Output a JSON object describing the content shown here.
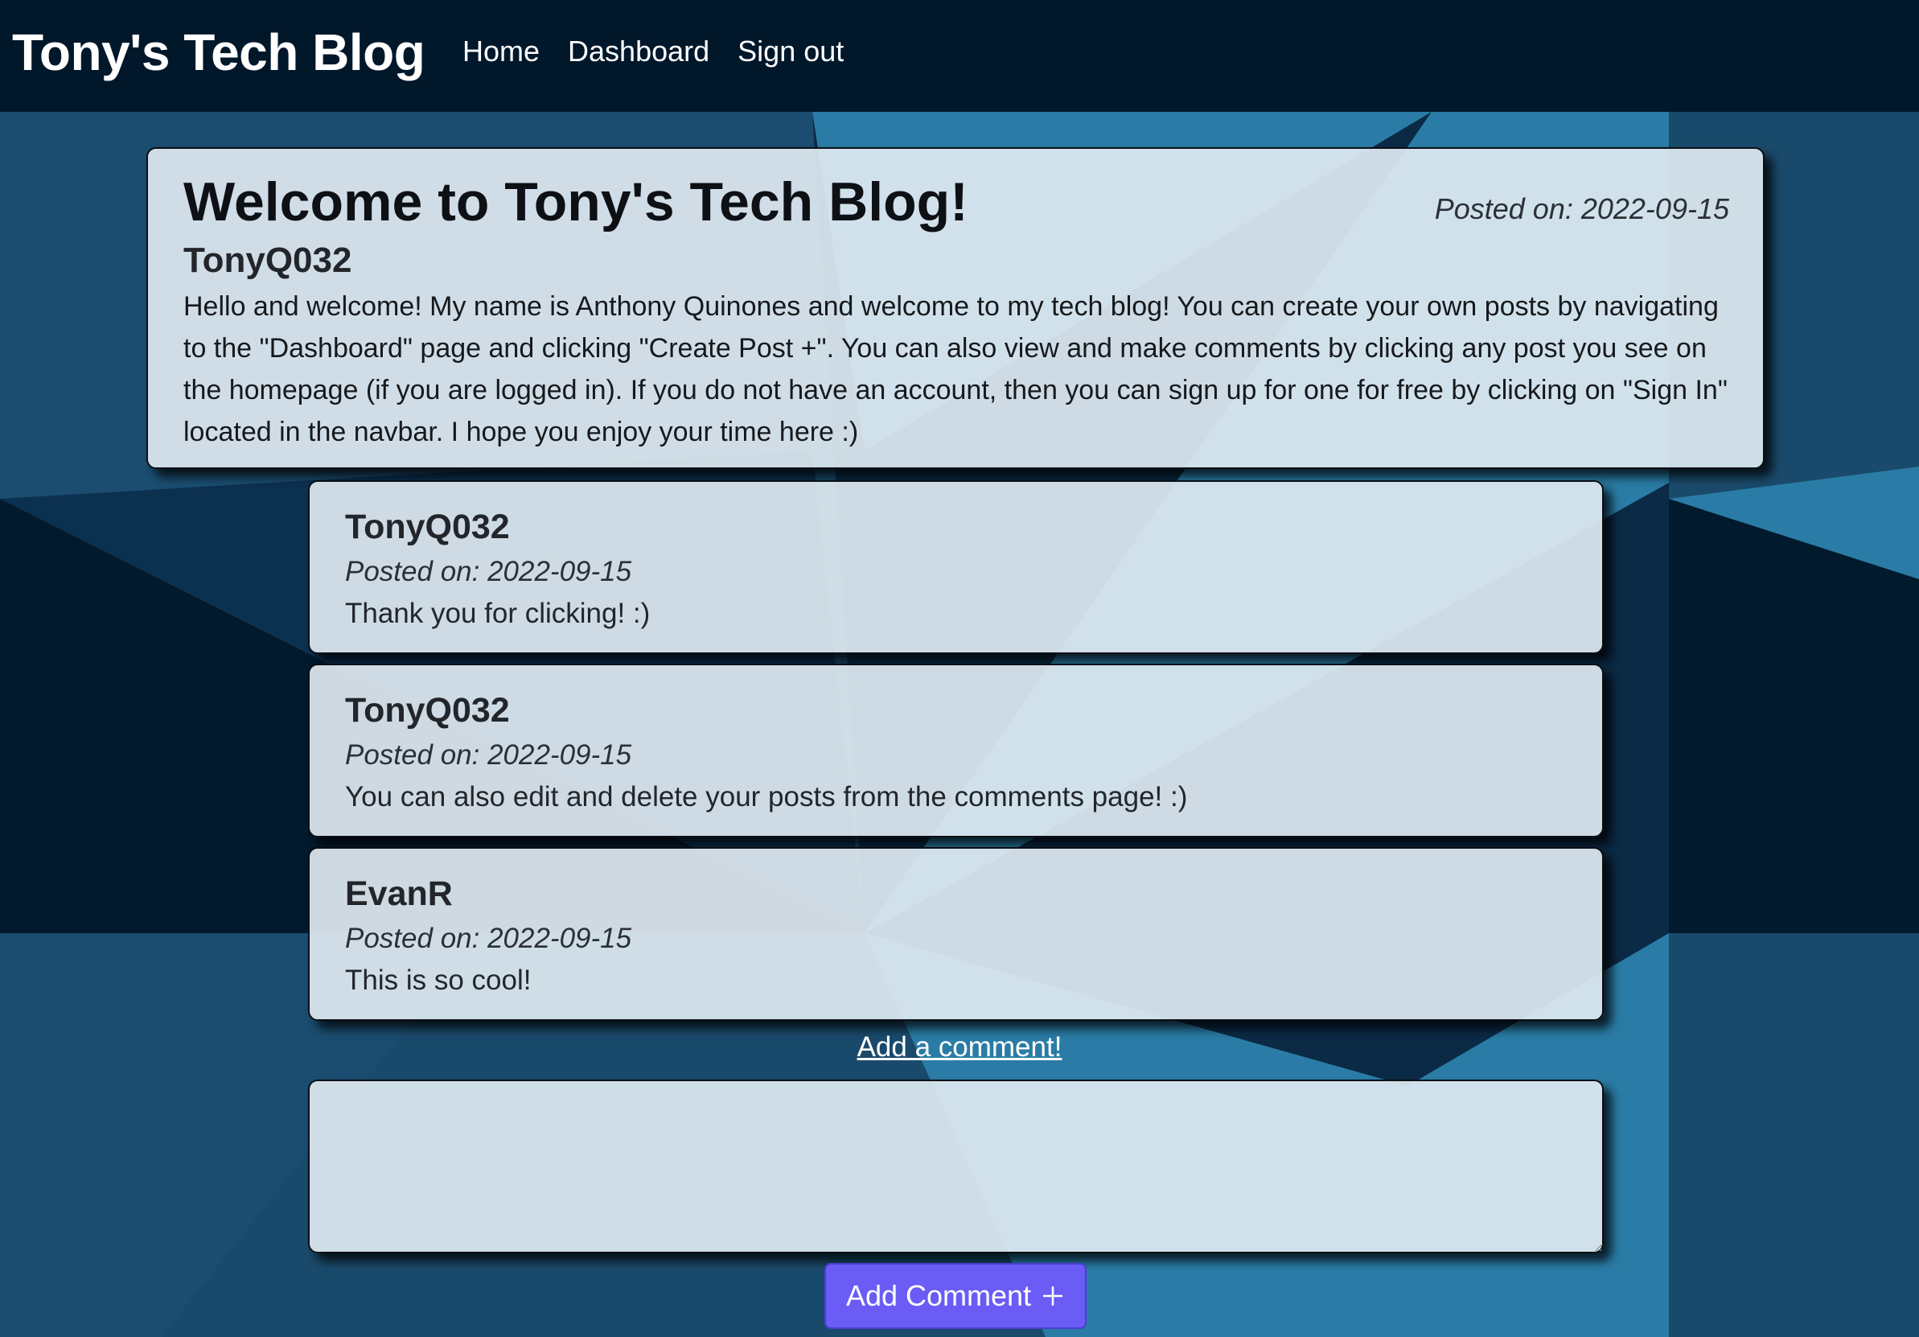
{
  "navbar": {
    "brand": "Tony's Tech Blog",
    "links": [
      {
        "label": "Home"
      },
      {
        "label": "Dashboard"
      },
      {
        "label": "Sign out"
      }
    ]
  },
  "post": {
    "title": "Welcome to Tony's Tech Blog!",
    "author": "TonyQ032",
    "date": "Posted on: 2022-09-15",
    "body": "Hello and welcome! My name is Anthony Quinones and welcome to my tech blog! You can create your own posts by navigating to the \"Dashboard\" page and clicking \"Create Post +\". You can also view and make comments by clicking any post you see on the homepage (if you are logged in). If you do not have an account, then you can sign up for one for free by clicking on \"Sign In\" located in the navbar. I hope you enjoy your time here :)"
  },
  "comments": [
    {
      "author": "TonyQ032",
      "date": "Posted on: 2022-09-15",
      "text": "Thank you for clicking! :)"
    },
    {
      "author": "TonyQ032",
      "date": "Posted on: 2022-09-15",
      "text": "You can also edit and delete your posts from the comments page! :)"
    },
    {
      "author": "EvanR",
      "date": "Posted on: 2022-09-15",
      "text": "This is so cool!"
    }
  ],
  "comment_form": {
    "link_label": "Add a comment!",
    "textarea_value": "",
    "button_label": "Add Comment",
    "button_icon": "plus-icon"
  },
  "colors": {
    "navbar_bg": "#01172a",
    "accent_button": "#6b5cf6",
    "card_bg": "#dee8f0"
  }
}
